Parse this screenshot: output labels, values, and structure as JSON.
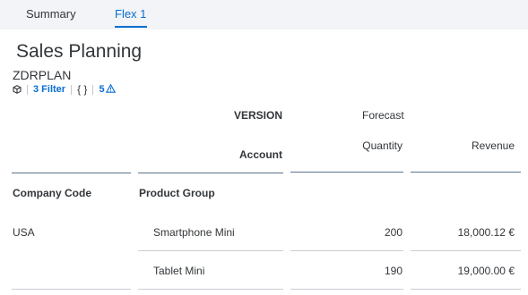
{
  "tabs": [
    {
      "label": "Summary",
      "active": false
    },
    {
      "label": "Flex 1",
      "active": true
    }
  ],
  "page": {
    "title": "Sales Planning",
    "subtitle": "ZDRPLAN",
    "filter_label": "3 Filter",
    "braces": "{ }",
    "warning_count": "5"
  },
  "colors": {
    "accent": "#0a6ed1",
    "tab_bar": "#f2f4f7",
    "text": "#32363a"
  },
  "table": {
    "header_version": "VERSION",
    "header_version_value": "Forecast",
    "header_account": "Account",
    "col_quantity": "Quantity",
    "col_revenue": "Revenue",
    "dim_company": "Company Code",
    "dim_product": "Product Group",
    "rows": [
      {
        "company": "USA",
        "product": "Smartphone Mini",
        "quantity": "200",
        "revenue": "18,000.12 €"
      },
      {
        "company": "",
        "product": "Tablet Mini",
        "quantity": "190",
        "revenue": "19,000.00 €"
      }
    ]
  }
}
